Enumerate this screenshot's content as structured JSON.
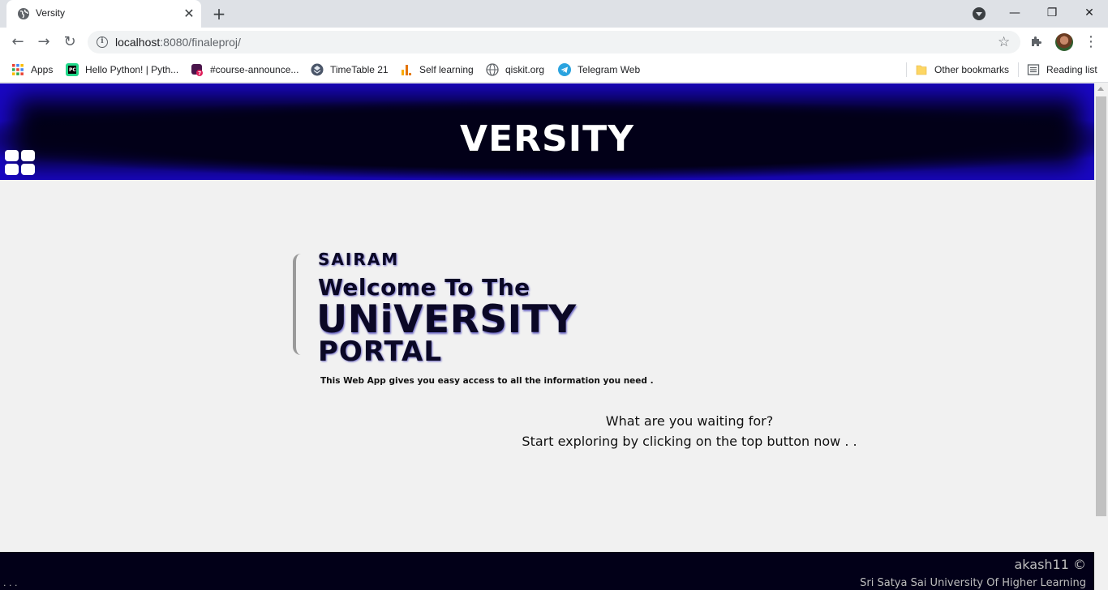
{
  "browser": {
    "tab_title": "Versity",
    "tab_close": "✕",
    "new_tab": "+",
    "url_host": "localhost",
    "url_rest": ":8080/finaleproj/",
    "window_controls": {
      "minimize": "—",
      "restore": "❐",
      "close": "✕"
    }
  },
  "bookmarks": [
    {
      "label": "Apps",
      "icon": "apps-grid-icon"
    },
    {
      "label": "Hello Python! | Pyth...",
      "icon": "pycharm-icon"
    },
    {
      "label": "#course-announce...",
      "icon": "slack-icon"
    },
    {
      "label": "TimeTable 21",
      "icon": "timetable-icon"
    },
    {
      "label": "Self learning",
      "icon": "analytics-icon"
    },
    {
      "label": "qiskit.org",
      "icon": "globe-icon"
    },
    {
      "label": "Telegram Web",
      "icon": "telegram-icon"
    },
    {
      "label": "Other bookmarks",
      "icon": "folder-icon"
    },
    {
      "label": "Reading list",
      "icon": "reading-list-icon"
    }
  ],
  "header": {
    "brand": "VERSITY"
  },
  "hero": {
    "kicker": "SAIRAM",
    "welcome": "Welcome To The",
    "university": "UNiVERSITY",
    "portal": "PORTAL",
    "tagline": "This Web App gives you easy access to all the information you need ."
  },
  "cta": {
    "line1": "What are you waiting for?",
    "line2": "Start exploring by clicking on the top button now . ."
  },
  "footer": {
    "author": "akash11 ©",
    "university": "Sri Satya Sai University Of Higher Learning",
    "dots": ". . ."
  },
  "colors": {
    "header_outer": "#2408f2",
    "header_inner": "#020018",
    "footer": "#020018",
    "page_bg": "#f1f1f1"
  }
}
